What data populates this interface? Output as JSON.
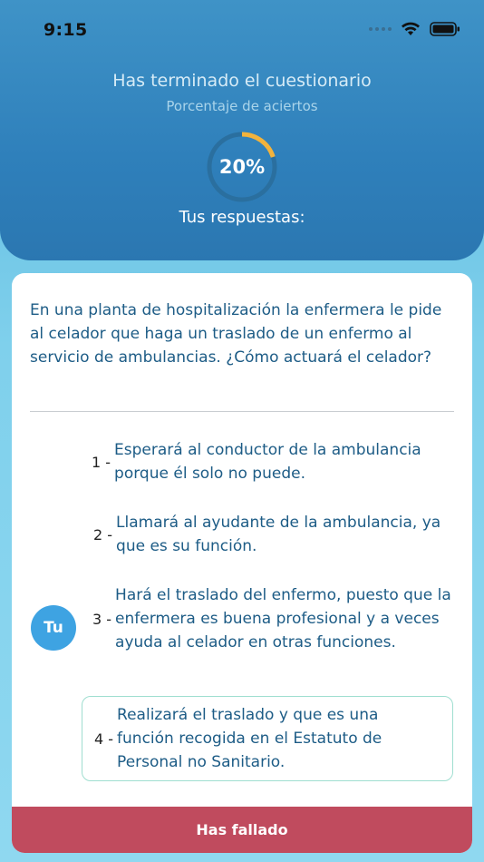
{
  "status_bar": {
    "time": "9:15"
  },
  "header": {
    "title": "Has terminado el cuestionario",
    "subtitle": "Porcentaje de aciertos",
    "score_label": "20%",
    "score_fraction": 0.2,
    "ring_color": "#f2b33d",
    "ring_track_color": "#2a6f9f",
    "answers_title": "Tus respuestas:"
  },
  "question": {
    "text": "En una planta de hospitalización la enfermera le pide al celador que haga un traslado de un enfermo al servicio de ambulancias. ¿Cómo actuará el celador?"
  },
  "options": [
    {
      "number": "1 -",
      "text": "Esperará al conductor de la ambulancia porque él solo no puede."
    },
    {
      "number": "2 -",
      "text": "Llamará al ayudante de la ambulancia, ya que es su función."
    },
    {
      "number": "3 -",
      "text": "Hará el traslado del enfermo, puesto que la enfermera es buena profesional y a veces ayuda al celador en otras funciones."
    },
    {
      "number": "4 -",
      "text": "Realizará el traslado y que es una función recogida en el Estatuto de Personal no Sanitario."
    }
  ],
  "user_answer_badge": "Tu",
  "result": {
    "label": "Has fallado",
    "color": "#c04b5e"
  }
}
